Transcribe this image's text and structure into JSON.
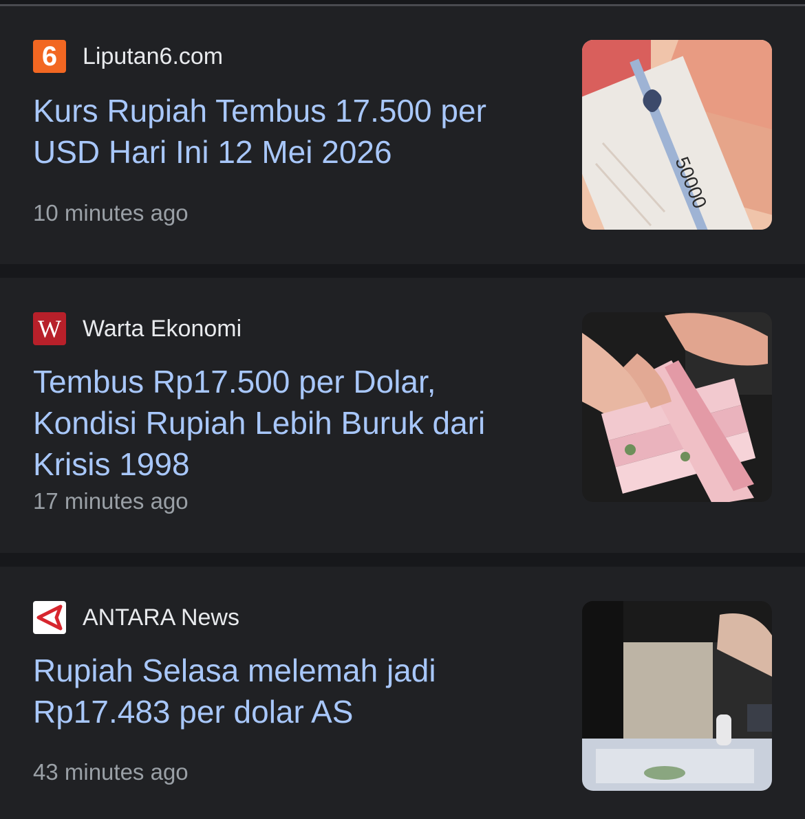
{
  "articles": [
    {
      "source": "Liputan6.com",
      "logo_text": "6",
      "headline": "Kurs Rupiah Tembus 17.500 per USD Hari Ini 12 Mei 2026",
      "time": "10 minutes ago",
      "banknote_label": "50000"
    },
    {
      "source": "Warta Ekonomi",
      "logo_text": "W",
      "headline": "Tembus Rp17.500 per Dolar, Kondisi Rupiah Lebih Buruk dari Krisis 1998",
      "time": "17 minutes ago"
    },
    {
      "source": "ANTARA News",
      "headline": "Rupiah Selasa melemah jadi Rp17.483 per dolar AS",
      "time": "43 minutes ago"
    }
  ],
  "colors": {
    "background": "#17181b",
    "card": "#202124",
    "headline": "#a8c7fa",
    "source": "#e8eaed",
    "time": "#9aa0a6",
    "liputan6_logo": "#f26722",
    "warta_logo": "#b8202a",
    "antara_logo": "#d7262e"
  }
}
